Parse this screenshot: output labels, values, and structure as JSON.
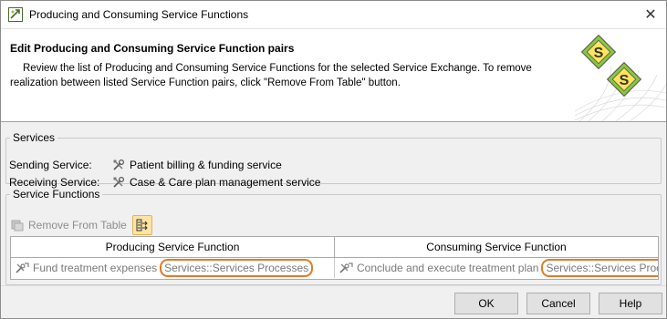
{
  "window": {
    "title": "Producing and Consuming Service Functions"
  },
  "header": {
    "title": "Edit Producing and Consuming Service Function pairs",
    "description_line1": "Review the list of Producing and Consuming Service Functions for the selected Service Exchange. To remove",
    "description_line2": "realization between listed Service Function pairs, click \"Remove From Table\" button."
  },
  "services": {
    "legend": "Services",
    "sending_label": "Sending Service:",
    "sending_value": "Patient billing & funding service",
    "receiving_label": "Receiving Service:",
    "receiving_value": "Case & Care plan management service"
  },
  "functions": {
    "legend": "Service Functions",
    "remove_label": "Remove From Table",
    "columns": [
      "Producing Service Function",
      "Consuming Service Function"
    ],
    "rows": [
      {
        "producing": "Fund treatment expenses",
        "producing_owner": "Services::Services Processes",
        "consuming": "Conclude and execute treatment plan",
        "consuming_owner": "Services::Services Processes"
      }
    ]
  },
  "buttons": {
    "ok": "OK",
    "cancel": "Cancel",
    "help": "Help"
  },
  "colors": {
    "highlight": "#e07b27",
    "icon_yellow": "#ffe45c",
    "icon_green": "#8ac53f"
  }
}
